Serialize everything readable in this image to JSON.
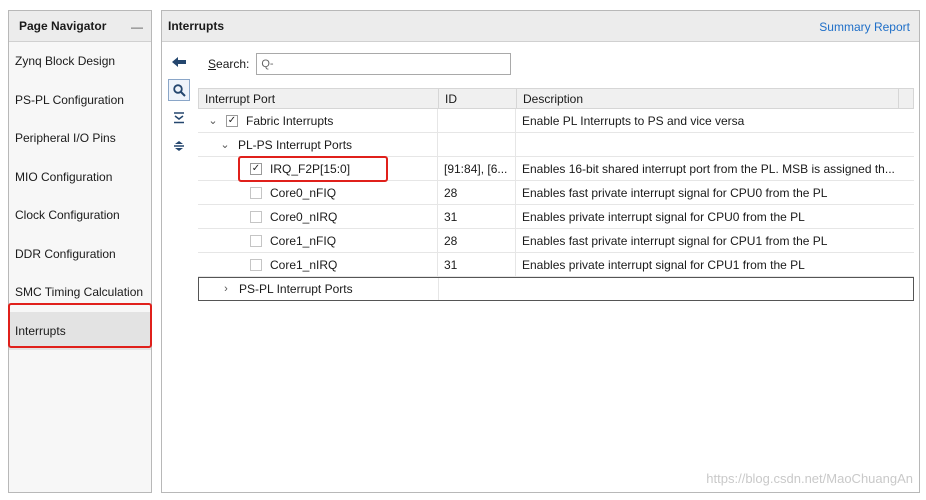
{
  "navigator": {
    "title": "Page Navigator",
    "minimize": "—",
    "items": [
      {
        "label": "Zynq Block Design"
      },
      {
        "label": "PS-PL Configuration"
      },
      {
        "label": "Peripheral I/O Pins"
      },
      {
        "label": "MIO Configuration"
      },
      {
        "label": "Clock Configuration"
      },
      {
        "label": "DDR Configuration"
      },
      {
        "label": "SMC Timing Calculation"
      },
      {
        "label": "Interrupts"
      }
    ]
  },
  "panel": {
    "title": "Interrupts",
    "summary_link": "Summary Report",
    "search": {
      "label_underlined": "S",
      "label_rest": "earch:",
      "placeholder": "Q-"
    },
    "columns": [
      "Interrupt Port",
      "ID",
      "Description"
    ],
    "rows": [
      {
        "name": "Fabric Interrupts",
        "id": "",
        "desc": "Enable PL Interrupts to PS and vice versa",
        "caret": "⌄",
        "checkbox": "checked"
      },
      {
        "name": "PL-PS Interrupt Ports",
        "id": "",
        "desc": "",
        "caret": "⌄",
        "checkbox": "none"
      },
      {
        "name": "IRQ_F2P[15:0]",
        "id": "[91:84], [6...",
        "desc": "Enables 16-bit shared interrupt port from the PL. MSB is assigned th...",
        "caret": "",
        "checkbox": "checked"
      },
      {
        "name": "Core0_nFIQ",
        "id": "28",
        "desc": "Enables fast private interrupt signal for CPU0 from the PL",
        "caret": "",
        "checkbox": "unchecked"
      },
      {
        "name": "Core0_nIRQ",
        "id": "31",
        "desc": "Enables private interrupt signal for CPU0 from the PL",
        "caret": "",
        "checkbox": "unchecked"
      },
      {
        "name": "Core1_nFIQ",
        "id": "28",
        "desc": "Enables fast private interrupt signal for CPU1 from the PL",
        "caret": "",
        "checkbox": "unchecked"
      },
      {
        "name": "Core1_nIRQ",
        "id": "31",
        "desc": "Enables private interrupt signal for CPU1 from the PL",
        "caret": "",
        "checkbox": "unchecked"
      },
      {
        "name": "PS-PL Interrupt Ports",
        "id": "",
        "desc": "",
        "caret": "›",
        "checkbox": "none"
      }
    ]
  },
  "watermark": "https://blog.csdn.net/MaoChuangAn",
  "colors": {
    "highlight": "#e0201b",
    "link": "#1f6fc8"
  }
}
